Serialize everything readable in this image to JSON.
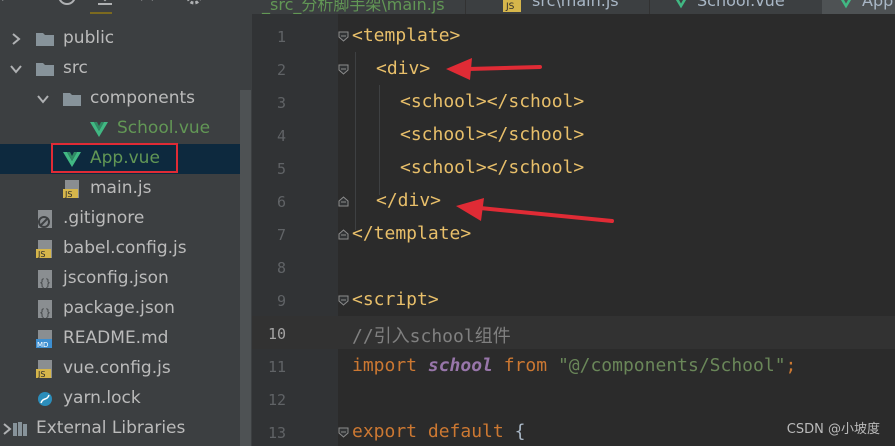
{
  "tree": {
    "items": [
      {
        "label": "public",
        "kind": "folder",
        "indent": 0,
        "expanded": false
      },
      {
        "label": "src",
        "kind": "folder",
        "indent": 0,
        "expanded": true
      },
      {
        "label": "components",
        "kind": "folder",
        "indent": 1,
        "expanded": true
      },
      {
        "label": "School.vue",
        "kind": "vue",
        "indent": 3
      },
      {
        "label": "App.vue",
        "kind": "vue",
        "indent": 2,
        "selected": true
      },
      {
        "label": "main.js",
        "kind": "js",
        "indent": 2
      },
      {
        "label": ".gitignore",
        "kind": "ignore",
        "indent": 1
      },
      {
        "label": "babel.config.js",
        "kind": "js",
        "indent": 1
      },
      {
        "label": "jsconfig.json",
        "kind": "json",
        "indent": 1
      },
      {
        "label": "package.json",
        "kind": "json",
        "indent": 1
      },
      {
        "label": "README.md",
        "kind": "md",
        "indent": 1
      },
      {
        "label": "vue.config.js",
        "kind": "js",
        "indent": 1
      },
      {
        "label": "yarn.lock",
        "kind": "yarn",
        "indent": 1
      },
      {
        "label": "External Libraries",
        "kind": "lib",
        "indent": 0
      }
    ]
  },
  "tabs": [
    "_src_分析脚手架\\main.js",
    "src\\main.js",
    "School.vue",
    "App"
  ],
  "editor": {
    "line_numbers": [
      "1",
      "2",
      "3",
      "4",
      "5",
      "6",
      "7",
      "8",
      "9",
      "10",
      "11",
      "12",
      "13"
    ],
    "current_line": "10",
    "lines": {
      "l1": {
        "a": "<template>"
      },
      "l2": {
        "a": "<div>"
      },
      "l3": {
        "a": "<school></school>"
      },
      "l4": {
        "a": "<school></school>"
      },
      "l5": {
        "a": "<school></school>"
      },
      "l6": {
        "a": "</div>"
      },
      "l7": {
        "a": "</template>"
      },
      "l9": {
        "a": "<script>"
      },
      "l10": {
        "a": "//引入school组件"
      },
      "l11": {
        "kw1": "import",
        "name": "school",
        "kw2": "from",
        "str": "\"@/components/School\"",
        "end": ";"
      },
      "l13": {
        "kw1": "export",
        "kw2": "default",
        "brace": "{"
      }
    }
  },
  "watermark": "CSDN @小坡度",
  "colors": {
    "annotation": "#e02b35",
    "vue_green": "#41b883",
    "selection": "#0d293e"
  }
}
